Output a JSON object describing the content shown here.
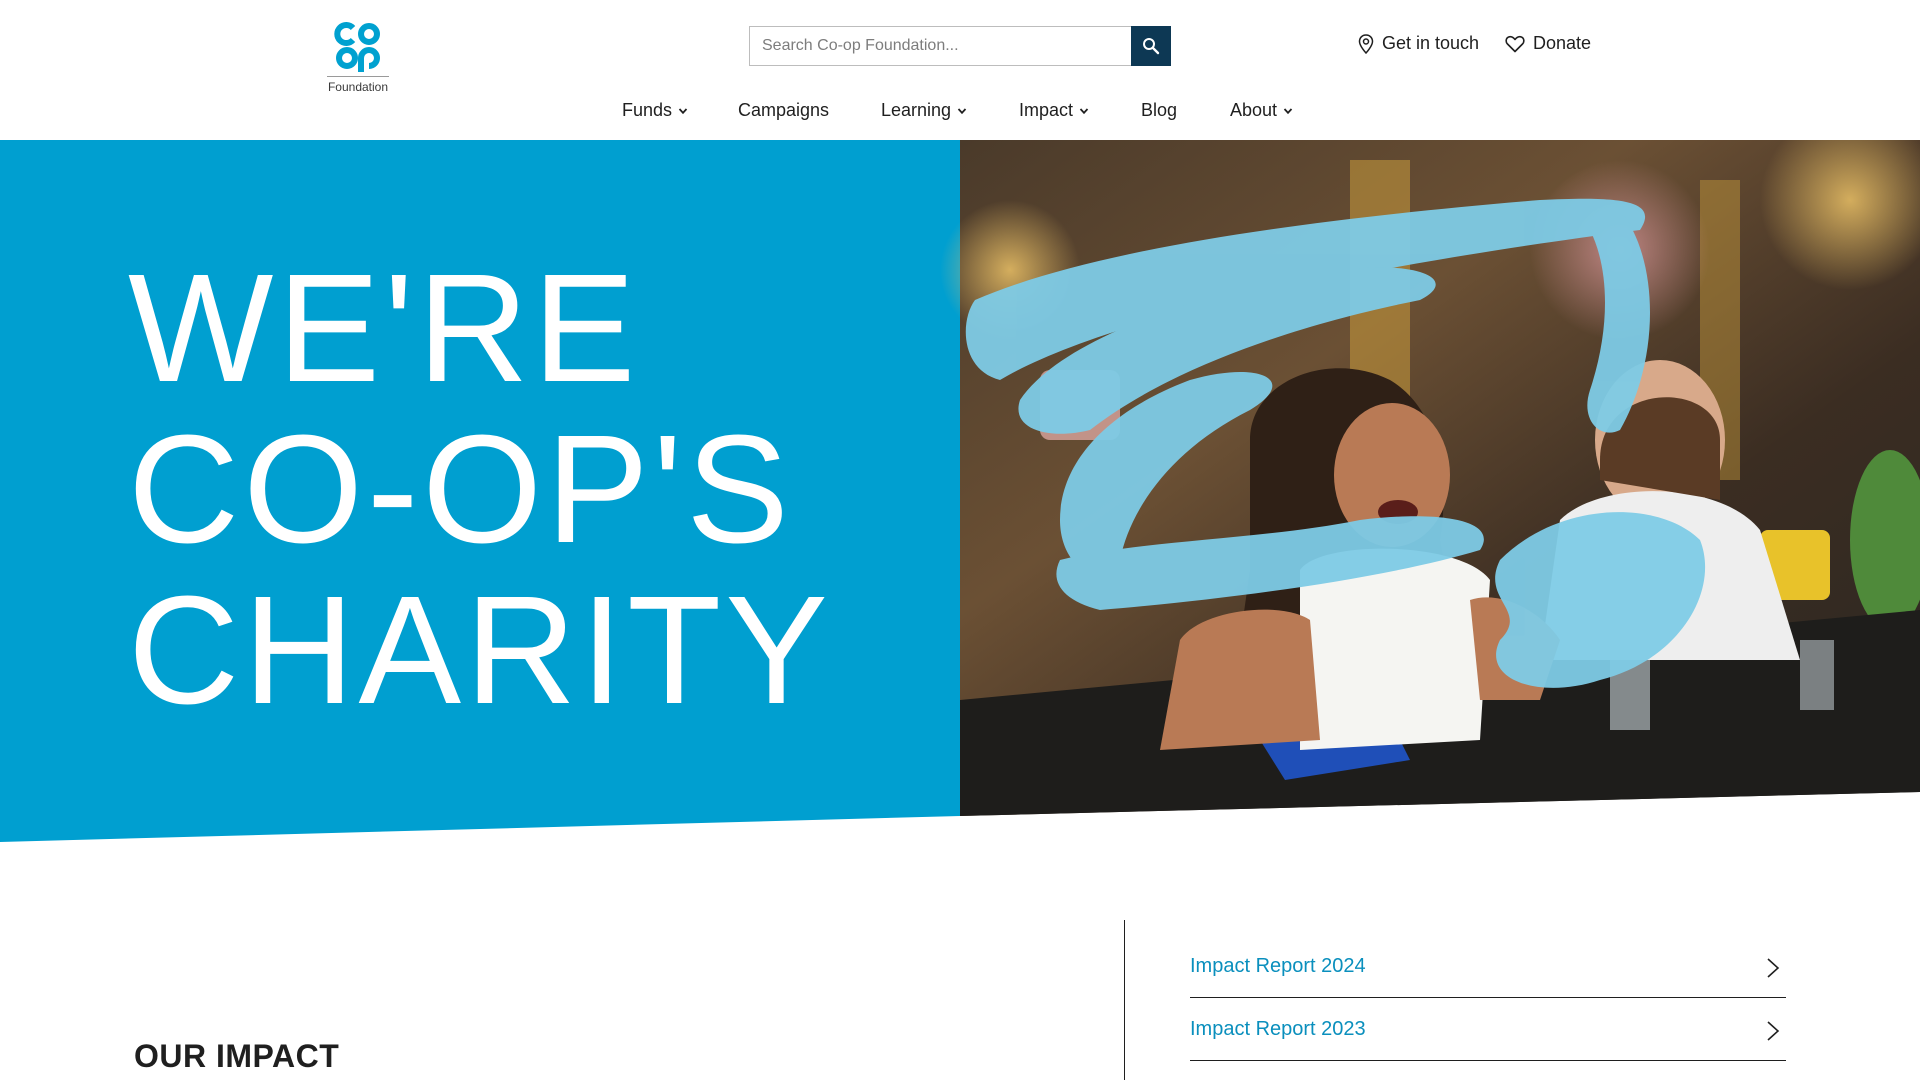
{
  "brand": {
    "logo_top": "co",
    "logo_bottom": "op",
    "logo_text": "Foundation",
    "color": "#00a1d0"
  },
  "search": {
    "placeholder": "Search Co-op Foundation...",
    "value": "",
    "icon": "search-icon",
    "button_color": "#0d3854"
  },
  "utility_links": {
    "contact": {
      "label": "Get in touch",
      "icon": "location-pin-icon"
    },
    "donate": {
      "label": "Donate",
      "icon": "heart-icon"
    }
  },
  "nav": {
    "items": [
      {
        "label": "Funds",
        "has_dropdown": true
      },
      {
        "label": "Campaigns",
        "has_dropdown": false
      },
      {
        "label": "Learning",
        "has_dropdown": true
      },
      {
        "label": "Impact",
        "has_dropdown": true
      },
      {
        "label": "Blog",
        "has_dropdown": false
      },
      {
        "label": "About",
        "has_dropdown": true
      }
    ]
  },
  "hero": {
    "lines": [
      "WE'RE",
      "CO-OP'S",
      "CHARITY"
    ],
    "background": "#009fd0",
    "brush_color": "#7ecbe6"
  },
  "impact": {
    "heading": "OUR IMPACT",
    "reports": [
      {
        "label": "Impact Report 2024"
      },
      {
        "label": "Impact Report 2023"
      }
    ],
    "link_color": "#0a8fbd"
  }
}
